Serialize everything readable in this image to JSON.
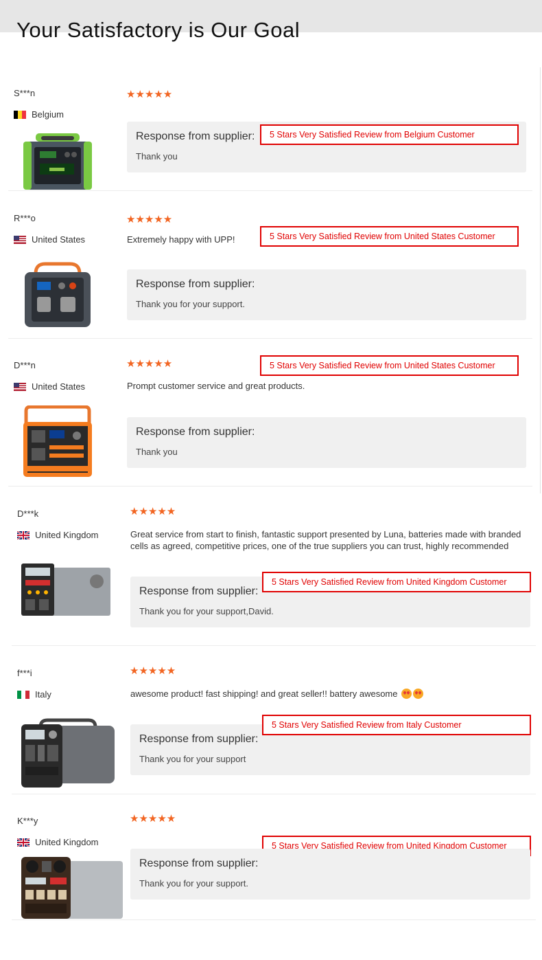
{
  "page": {
    "title": "Your Satisfactory is Our Goal"
  },
  "colors": {
    "star": "#f26522",
    "badge_border": "#e00000",
    "response_bg": "#f0f0f0",
    "header_band": "#e6e6e6"
  },
  "reviews": [
    {
      "name": "S***n",
      "country": "Belgium",
      "flag_icon": "belgium-flag-icon",
      "rating": 5,
      "stars": "★★★★★",
      "comment": "",
      "response_label": "Response from supplier:",
      "response": "Thank you",
      "badge": "5 Stars Very Satisfied Review from Belgium Customer"
    },
    {
      "name": "R***o",
      "country": "United States",
      "flag_icon": "us-flag-icon",
      "rating": 5,
      "stars": "★★★★★",
      "comment": "Extremely happy with UPP!",
      "response_label": "Response from supplier:",
      "response": "Thank you for your support.",
      "badge": "5 Stars Very Satisfied Review from United States Customer"
    },
    {
      "name": "D***n",
      "country": "United States",
      "flag_icon": "us-flag-icon",
      "rating": 5,
      "stars": "★★★★★",
      "comment": "Prompt customer service and great products.",
      "response_label": "Response from supplier:",
      "response": "Thank you",
      "badge": "5 Stars Very Satisfied Review from United States Customer"
    },
    {
      "name": "D***k",
      "country": "United Kingdom",
      "flag_icon": "uk-flag-icon",
      "rating": 5,
      "stars": "★★★★★",
      "comment": "Great service from start to finish, fantastic support presented by Luna, batteries made with branded cells as agreed, competitive prices, one of the true suppliers you can trust, highly recommended",
      "response_label": "Response from supplier:",
      "response": "Thank you for your support,David.",
      "badge": "5 Stars Very Satisfied Review from United Kingdom Customer"
    },
    {
      "name": "f***i",
      "country": "Italy",
      "flag_icon": "italy-flag-icon",
      "rating": 5,
      "stars": "★★★★★",
      "comment": "awesome product! fast shipping! and great seller!! battery awesome",
      "response_label": "Response from supplier:",
      "response": "Thank you for your support",
      "badge": "5 Stars Very Satisfied Review from Italy Customer"
    },
    {
      "name": "K***y",
      "country": "United Kingdom",
      "flag_icon": "uk-flag-icon",
      "rating": 5,
      "stars": "★★★★★",
      "comment": "",
      "response_label": "Response from supplier:",
      "response": "Thank you for your support.",
      "badge": "5 Stars Very Satisfied Review from United Kingdom Customer"
    }
  ]
}
